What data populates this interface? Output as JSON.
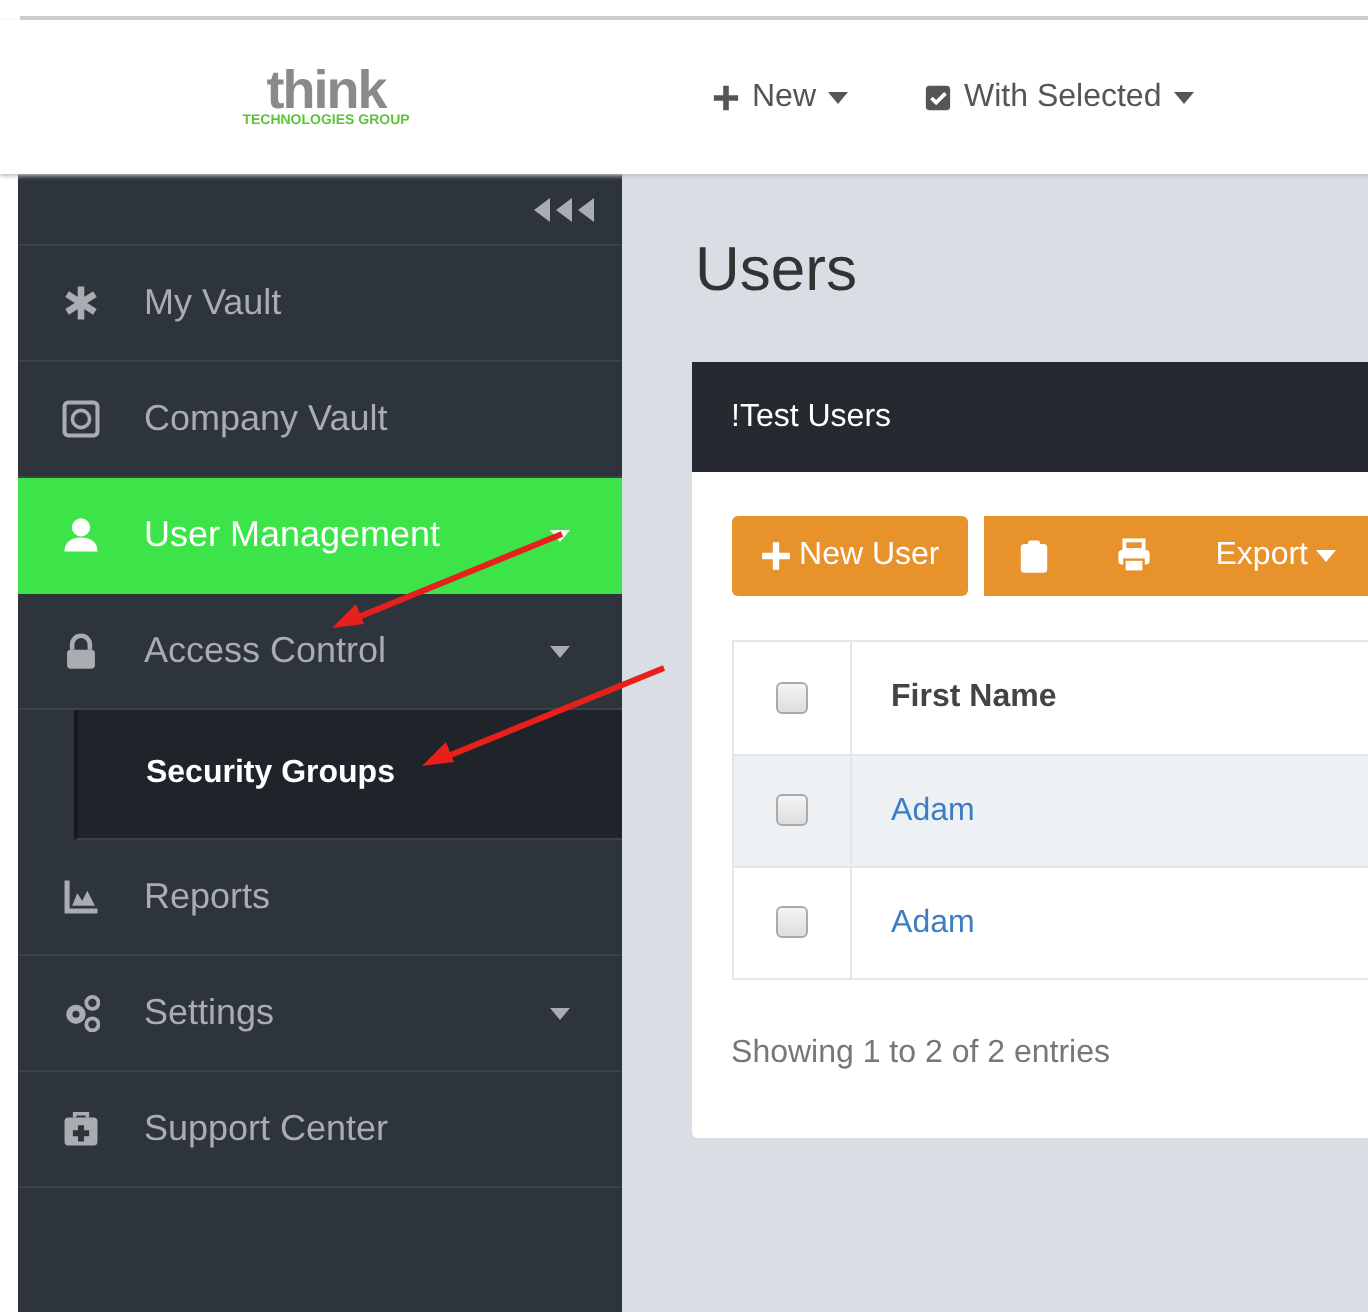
{
  "logo": {
    "word": "think",
    "tagline": "TECHNOLOGIES GROUP"
  },
  "top_nav": [
    {
      "label": "New"
    },
    {
      "label": "With Selected"
    }
  ],
  "sidebar": {
    "items": [
      {
        "label": "My Vault",
        "dropdown": false,
        "selected": false
      },
      {
        "label": "Company Vault",
        "dropdown": false,
        "selected": false
      },
      {
        "label": "User Management",
        "dropdown": true,
        "selected": true
      },
      {
        "label": "Access Control",
        "dropdown": true,
        "selected": false,
        "children": [
          {
            "label": "Security Groups",
            "selected": true
          }
        ]
      },
      {
        "label": "Reports",
        "dropdown": false,
        "selected": false
      },
      {
        "label": "Settings",
        "dropdown": true,
        "selected": false
      },
      {
        "label": "Support Center",
        "dropdown": false,
        "selected": false
      }
    ]
  },
  "page_title": "Users",
  "panel": {
    "title": "!Test Users",
    "toolbar": [
      {
        "kind": "add",
        "label": "New User"
      },
      {
        "kind": "copy"
      },
      {
        "kind": "print"
      },
      {
        "kind": "dropdown",
        "label": "Export"
      }
    ],
    "table": {
      "select_all": {
        "checked": false
      },
      "columns": [
        "First Name"
      ],
      "rows": [
        {
          "checked": false,
          "first_name": "Adam"
        },
        {
          "checked": false,
          "first_name": "Adam"
        }
      ]
    },
    "footer": "Showing 1 to 2 of 2 entries"
  }
}
